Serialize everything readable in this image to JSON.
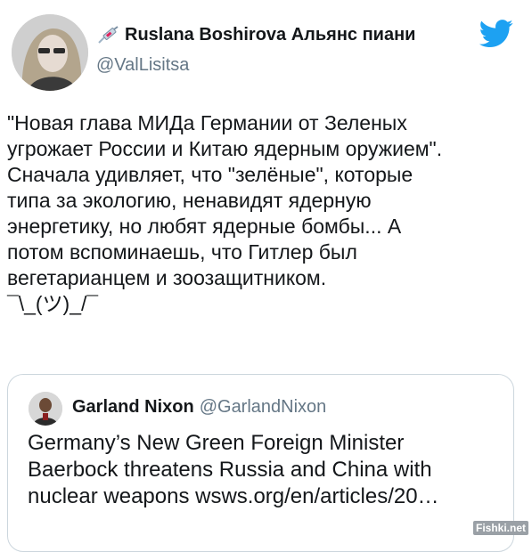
{
  "author": {
    "name": "Ruslana Boshirova Альянс пиани",
    "handle": "@ValLisitsa",
    "name_icon": "syringe-icon"
  },
  "platform_icon": "twitter-bird-icon",
  "tweet": {
    "text": "\"Новая глава МИДа Германии от Зеленых\nугрожает России и Китаю ядерным оружием\".\nСначала удивляет, что \"зелёные\", которые\nтипа за экологию, ненавидят ядерную\nэнергетику, но любят ядерные бомбы... А\nпотом вспоминаешь, что Гитлер был\nвегетарианцем и зоозащитником.\n¯\\_(ツ)_/¯"
  },
  "quoted_tweet": {
    "name": "Garland Nixon",
    "handle": "@GarlandNixon",
    "text": "Germany’s New Green Foreign Minister\nBaerbock threatens Russia and China with\nnuclear weapons wsws.org/en/articles/20…"
  },
  "watermark": "Fishki.net",
  "colors": {
    "twitter_blue": "#1da1f2",
    "secondary_text": "#657786",
    "border": "#ccd6dd"
  }
}
